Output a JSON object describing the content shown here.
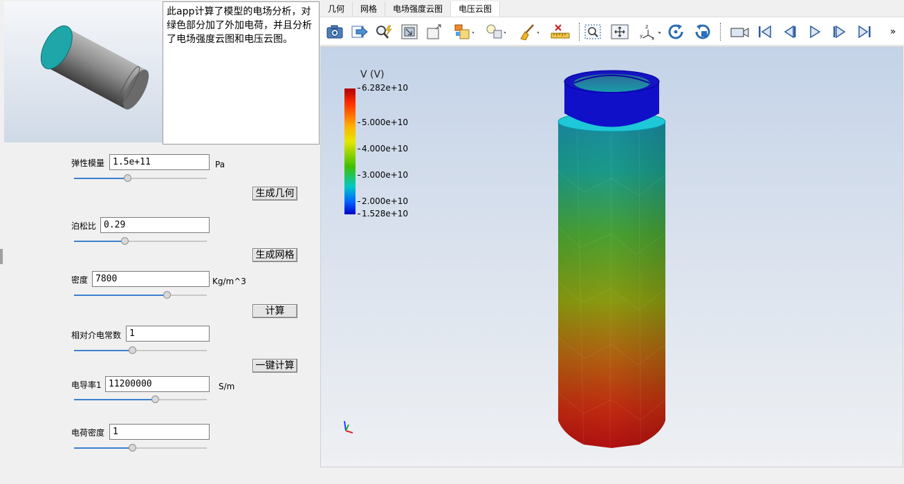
{
  "description": "此app计算了模型的电场分析，对绿色部分加了外加电荷，并且分析了电场强度云图和电压云图。",
  "params": [
    {
      "label": "弹性模量",
      "value": "1.5e+11",
      "unit": "Pa",
      "slider": 0.4
    },
    {
      "label": "泊松比",
      "value": "0.29",
      "unit": "",
      "slider": 0.38
    },
    {
      "label": "密度",
      "value": "7800",
      "unit": "Kg/m^3",
      "slider": 0.7
    },
    {
      "label": "相对介电常数",
      "value": "1",
      "unit": "",
      "slider": 0.44
    },
    {
      "label": "电导率1",
      "value": "11200000",
      "unit": "S/m",
      "slider": 0.61
    },
    {
      "label": "电荷密度",
      "value": "1",
      "unit": "",
      "slider": 0.44
    }
  ],
  "buttons": {
    "gen_geometry": "生成几何",
    "gen_mesh": "生成网格",
    "compute": "计算",
    "one_click": "一键计算"
  },
  "tabs": [
    "几何",
    "网格",
    "电场强度云图",
    "电压云图"
  ],
  "active_tab": 3,
  "toolbar": {
    "icons": [
      "camera-icon",
      "export-icon",
      "query-icon",
      "fit-view-icon",
      "box-view-icon",
      "color-cube-icon",
      "light-icon",
      "clear-brush-icon",
      "ruler-icon",
      "zoom-box-icon",
      "pan-icon",
      "axes-orient-icon",
      "rotate-cw-icon",
      "rotate-ccw-icon",
      "video-camera-icon",
      "first-frame-icon",
      "prev-frame-icon",
      "play-icon",
      "next-frame-icon",
      "last-frame-icon"
    ],
    "overflow": "»"
  },
  "legend": {
    "title": "V (V)",
    "max": "6.282e+10",
    "min": "1.528e+10",
    "ticks": [
      "5.000e+10",
      "4.000e+10",
      "3.000e+10",
      "2.000e+10"
    ],
    "colors": [
      "#b00000",
      "#ff3000",
      "#ffb000",
      "#e6e600",
      "#40c000",
      "#00c8c8",
      "#0064ff",
      "#0000c8"
    ]
  }
}
